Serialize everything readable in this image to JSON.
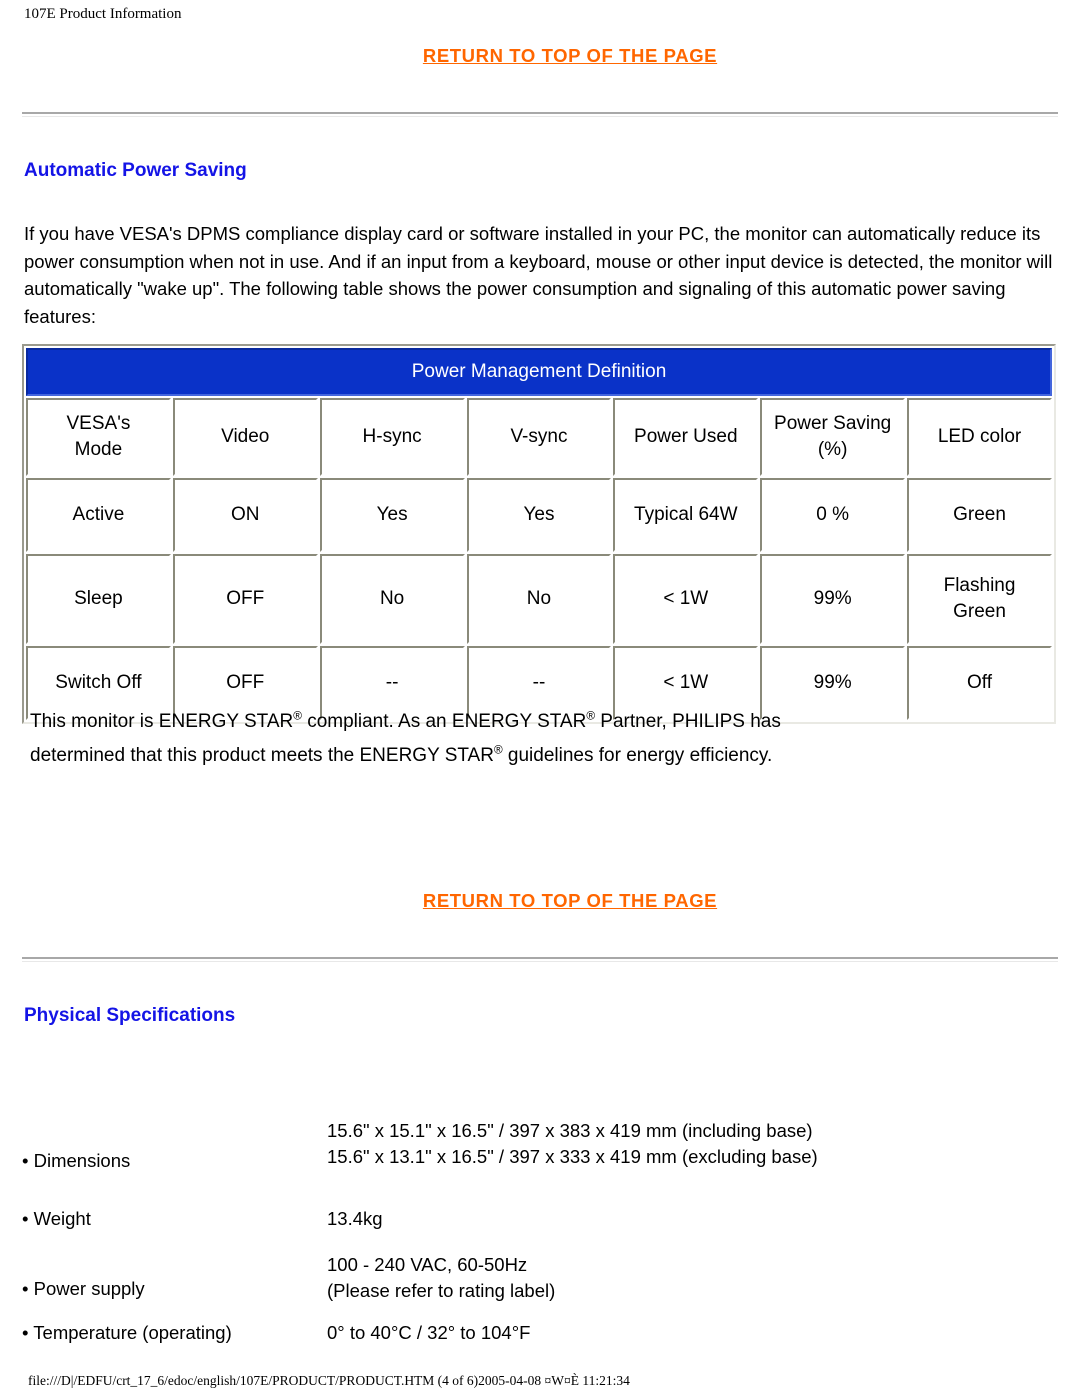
{
  "page": {
    "header": "107E Product Information",
    "footer": "file:///D|/EDFU/crt_17_6/edoc/english/107E/PRODUCT/PRODUCT.HTM (4 of 6)2005-04-08 ¤W¤È 11:21:34"
  },
  "links": {
    "return_top_1": "RETURN TO TOP OF THE PAGE",
    "return_top_2": "RETURN TO TOP OF THE PAGE"
  },
  "sections": {
    "power_saving": {
      "title": "Automatic Power Saving",
      "intro": "If you have VESA's DPMS compliance display card or software installed in your PC, the monitor can automatically reduce its power consumption when not in use. And if an input from a keyboard, mouse or other input device is detected, the monitor will automatically \"wake up\". The following table shows the power consumption and signaling of this automatic power saving features:",
      "energy_star": {
        "p1_a": "This monitor is ENERGY STAR",
        "p1_sup1": "®",
        "p1_b": " compliant. As an ENERGY STAR",
        "p1_sup2": "®",
        "p1_c": " Partner, PHILIPS has",
        "p2_a": "determined that this product meets the ENERGY STAR",
        "p2_sup3": "®",
        "p2_b": " guidelines for energy efficiency."
      }
    },
    "physical": {
      "title": "Physical Specifications"
    }
  },
  "power_table": {
    "banner": "Power Management Definition",
    "columns": [
      "VESA's Mode",
      "Video",
      "H-sync",
      "V-sync",
      "Power Used",
      "Power Saving (%)",
      "LED color"
    ],
    "columns_multiline": {
      "c0_line1": "VESA's",
      "c0_line2": "Mode",
      "c1": "Video",
      "c2": "H-sync",
      "c3": "V-sync",
      "c4": "Power Used",
      "c5_line1": "Power Saving",
      "c5_line2": "(%)",
      "c6": "LED color"
    },
    "rows": [
      {
        "mode": "Active",
        "video": "ON",
        "hsync": "Yes",
        "vsync": "Yes",
        "power_used": "Typical 64W",
        "power_saving": "0 %",
        "led_line1": "Green",
        "led_line2": ""
      },
      {
        "mode": "Sleep",
        "video": "OFF",
        "hsync": "No",
        "vsync": "No",
        "power_used": "< 1W",
        "power_saving": "99%",
        "led_line1": "Flashing",
        "led_line2": "Green"
      },
      {
        "mode": "Switch Off",
        "video": "OFF",
        "hsync": "--",
        "vsync": "--",
        "power_used": "< 1W",
        "power_saving": "99%",
        "led_line1": "Off",
        "led_line2": ""
      }
    ]
  },
  "physical_specs": [
    {
      "label": "• Dimensions",
      "value_line1": "15.6\" x 15.1\" x 16.5\" / 397 x 383 x 419 mm (including base)",
      "value_line2": "15.6\" x 13.1\" x 16.5\" / 397 x 333 x 419 mm (excluding base)"
    },
    {
      "label": "• Weight",
      "value_line1": "13.4kg",
      "value_line2": ""
    },
    {
      "label": "• Power supply",
      "value_line1": "100 - 240 VAC, 60-50Hz",
      "value_line2": "(Please refer to rating label)"
    },
    {
      "label": "• Temperature (operating)",
      "value_line1": "0° to 40°C / 32° to 104°F",
      "value_line2": ""
    }
  ],
  "colors": {
    "link": "#FF6600",
    "heading": "#1414E6",
    "table_banner": "#0A32C8"
  }
}
